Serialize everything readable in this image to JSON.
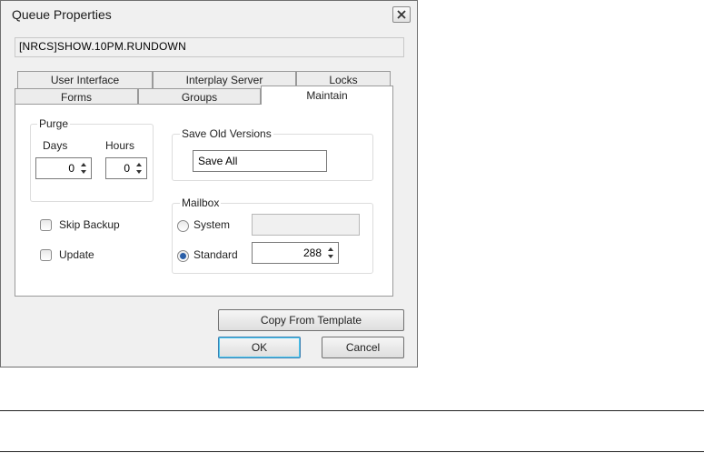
{
  "window": {
    "title": "Queue Properties"
  },
  "queue_path": "[NRCS]SHOW.10PM.RUNDOWN",
  "tabs_back": [
    "User Interface",
    "Interplay Server",
    "Locks"
  ],
  "tabs_front": [
    "Forms",
    "Groups",
    "Maintain"
  ],
  "active_tab": "Maintain",
  "purge": {
    "label": "Purge",
    "days_label": "Days",
    "hours_label": "Hours",
    "days_value": "0",
    "hours_value": "0"
  },
  "save_old_versions": {
    "label": "Save Old Versions",
    "value": "Save All"
  },
  "options": {
    "skip_backup": "Skip Backup",
    "update": "Update"
  },
  "mailbox": {
    "label": "Mailbox",
    "system_label": "System",
    "standard_label": "Standard",
    "system_value": "",
    "standard_value": "288",
    "selected": "Standard"
  },
  "buttons": {
    "copy_template": "Copy From Template",
    "ok": "OK",
    "cancel": "Cancel"
  },
  "colors": {
    "radio_selected": "#2a5fa8",
    "default_button_border": "#3c7fb1"
  }
}
